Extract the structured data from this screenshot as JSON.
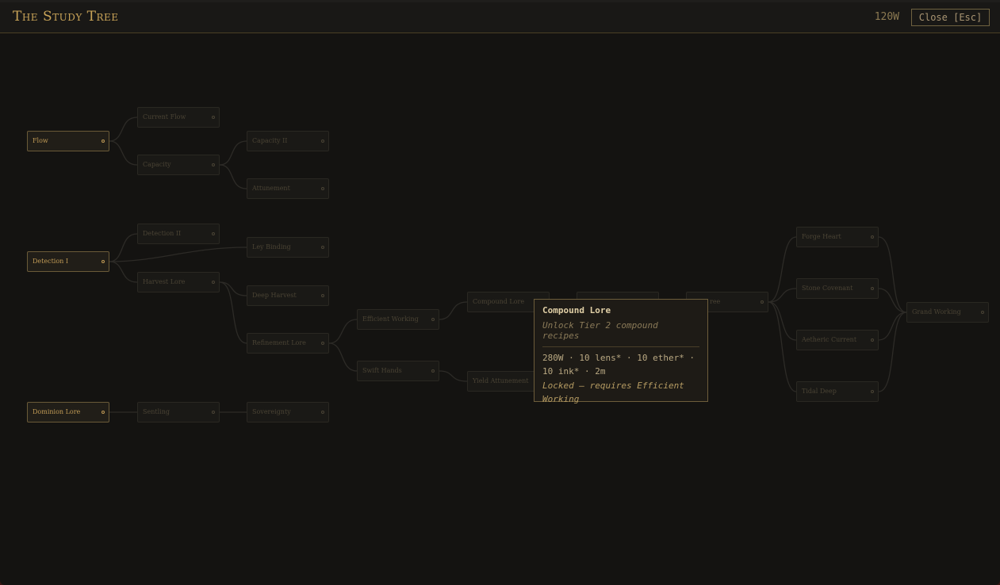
{
  "header": {
    "title": "The Study Tree",
    "wealth": "120W",
    "close_label": "Close [Esc]"
  },
  "nodes": {
    "flow": "Flow",
    "current_flow": "Current Flow",
    "capacity": "Capacity",
    "capacity_ii": "Capacity II",
    "attunement": "Attunement",
    "detection_i": "Detection I",
    "detection_ii": "Detection II",
    "ley_binding": "Ley Binding",
    "harvest_lore": "Harvest Lore",
    "deep_harvest": "Deep Harvest",
    "refinement_lore": "Refinement Lore",
    "efficient_working": "Efficient Working",
    "swift_hands": "Swift Hands",
    "compound_lore": "Compound Lore",
    "yield_attunement": "Yield Attunement",
    "hidden_mid": "",
    "partial_ree": "ree",
    "forge_heart": "Forge Heart",
    "stone_covenant": "Stone Covenant",
    "aetheric_current": "Aetheric Current",
    "tidal_deep": "Tidal Deep",
    "grand_working": "Grand Working",
    "dominion_lore": "Dominion Lore",
    "sentling": "Sentling",
    "sovereignty": "Sovereignty"
  },
  "tooltip": {
    "title": "Compound Lore",
    "description": "Unlock Tier 2 compound recipes",
    "cost_line1": "280W · 10 lens* · 10 ether* ·",
    "cost_line2": "10 ink* · 2m",
    "lock_line1": "Locked — requires Efficient",
    "lock_line2": "Working"
  },
  "colors": {
    "accent": "#c9a458",
    "background": "#141311",
    "node_border": "#2a2822",
    "link": "#2d2b27"
  }
}
